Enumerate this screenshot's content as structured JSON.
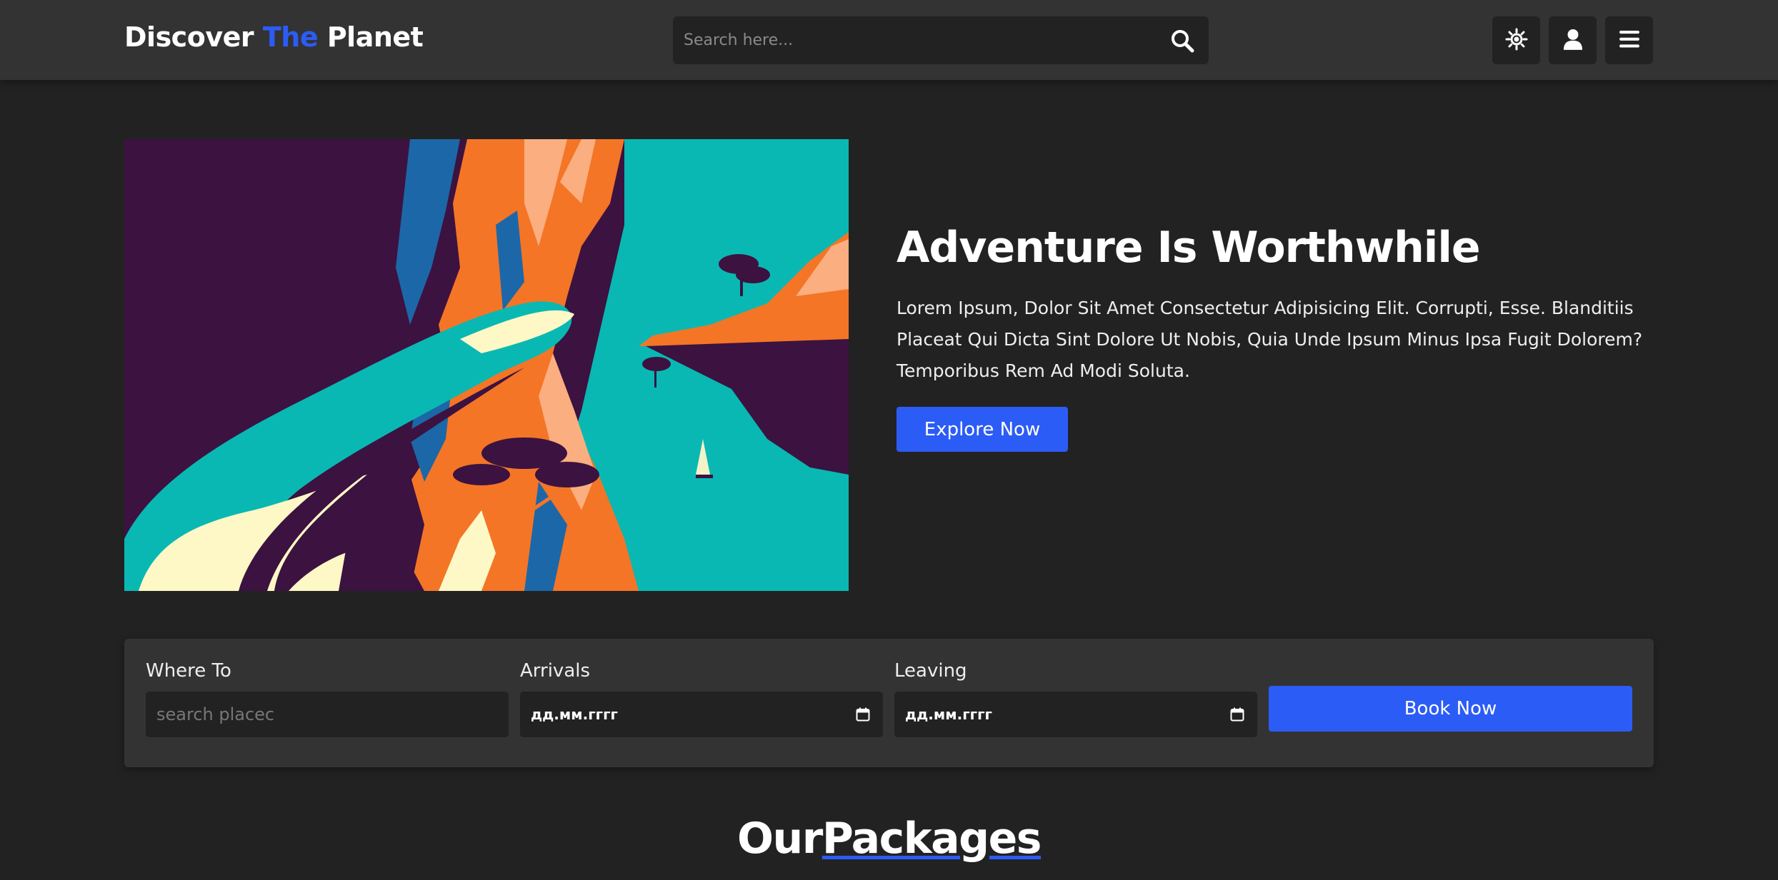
{
  "header": {
    "logo": {
      "part1": "Discover ",
      "accent": "The",
      "part2": " Planet"
    },
    "search": {
      "placeholder": "Search here...",
      "value": ""
    },
    "icons": [
      "search-icon",
      "sun-icon",
      "user-icon",
      "menu-icon"
    ]
  },
  "hero": {
    "image_description": "Illustrated coastal cliffs with a winding road and turquoise sea",
    "title": "Adventure Is Worthwhile",
    "text": "Lorem Ipsum, Dolor Sit Amet Consectetur Adipisicing Elit. Corrupti, Esse. Blanditiis Placeat Qui Dicta Sint Dolore Ut Nobis, Quia Unde Ipsum Minus Ipsa Fugit Dolorem? Temporibus Rem Ad Modi Soluta.",
    "button_label": "Explore Now"
  },
  "booking": {
    "where_label": "Where To",
    "where_placeholder": "search placec",
    "arrivals_label": "Arrivals",
    "arrivals_value": "дд.мм.гггг",
    "leaving_label": "Leaving",
    "leaving_value": "дд.мм.гггг",
    "book_label": "Book Now"
  },
  "packages": {
    "title_part1": "Our",
    "title_part2": "Packages"
  },
  "colors": {
    "accent": "#2c5cf6",
    "background": "#222222",
    "surface": "#333333"
  }
}
